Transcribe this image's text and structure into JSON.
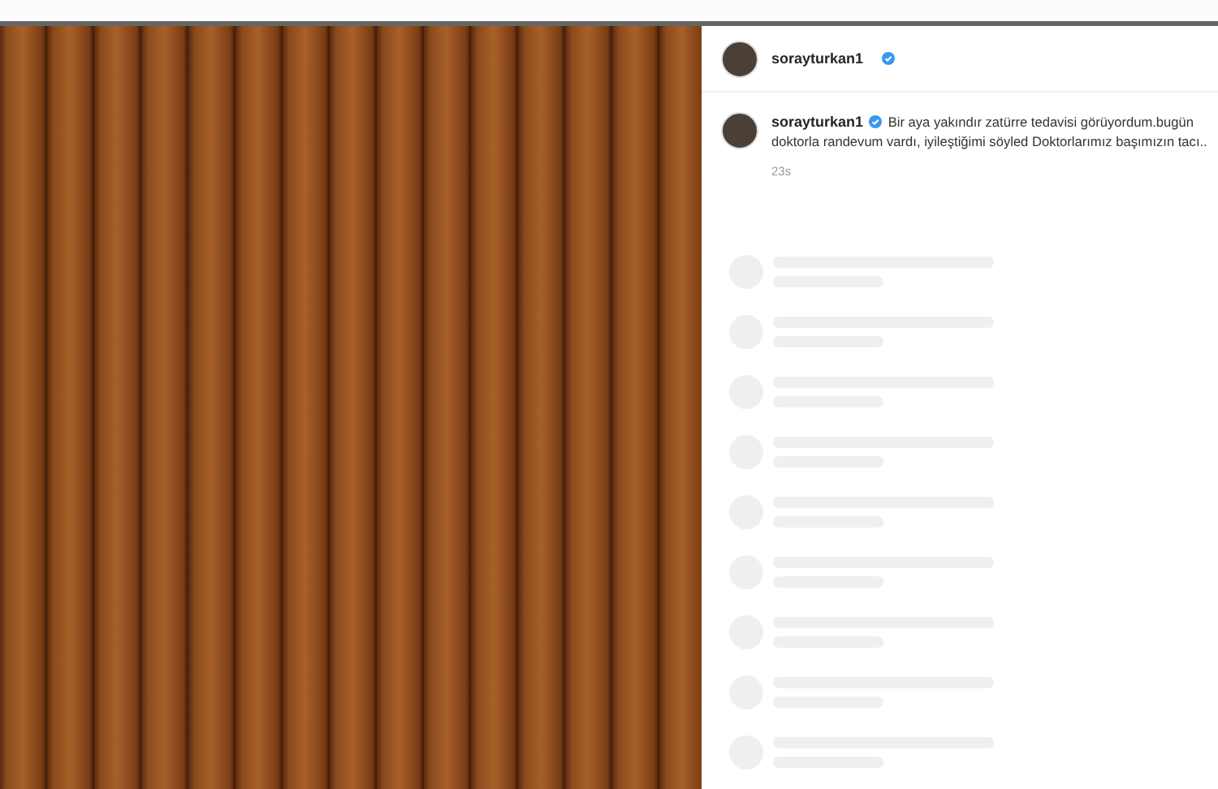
{
  "post": {
    "photo": {
      "kind": "photo"
    },
    "header": {
      "username": "sorayturkan1",
      "verified": true
    },
    "caption": {
      "username": "sorayturkan1",
      "verified": true,
      "text": "Bir aya yakındır zatürre tedavisi görüyordum.bugün doktorla randevum vardı, iyileştiğimi söyled Doktorlarımız başımızın tacı..",
      "time": "23s"
    },
    "comment_placeholders": [
      {
        "kind": "skeleton"
      },
      {
        "kind": "skeleton"
      },
      {
        "kind": "skeleton"
      },
      {
        "kind": "skeleton"
      },
      {
        "kind": "skeleton"
      },
      {
        "kind": "skeleton"
      },
      {
        "kind": "skeleton"
      },
      {
        "kind": "skeleton"
      },
      {
        "kind": "skeleton"
      }
    ]
  }
}
